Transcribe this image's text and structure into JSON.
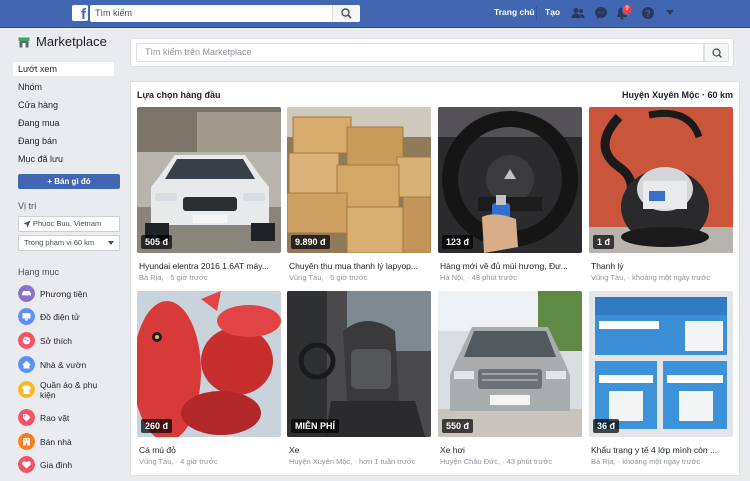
{
  "topbar": {
    "logo": "f",
    "search_placeholder": "Tìm kiếm",
    "home": "Trang chủ",
    "create": "Tạo",
    "notif_count": "9",
    "icons": [
      "friends-icon",
      "messenger-icon",
      "bell-icon",
      "help-icon",
      "caret-down-icon"
    ]
  },
  "sidebar": {
    "title": "Marketplace",
    "nav": [
      {
        "label": "Lướt xem",
        "active": true
      },
      {
        "label": "Nhóm"
      },
      {
        "label": "Cửa hàng"
      },
      {
        "label": "Đang mua"
      },
      {
        "label": "Đang bán"
      },
      {
        "label": "Mục đã lưu"
      }
    ],
    "sell_button": "+ Bán gì đó",
    "location_heading": "Vị trí",
    "location_value": "Phuoc Buu, Vietnam",
    "radius_value": "Trong phạm vi 60 km",
    "categories_heading": "Hạng mục",
    "categories": [
      {
        "label": "Phương tiện",
        "color": "#8c72cb"
      },
      {
        "label": "Đồ điện tử",
        "color": "#5890ff"
      },
      {
        "label": "Sở thích",
        "color": "#f35369"
      },
      {
        "label": "Nhà & vườn",
        "color": "#5890ff"
      },
      {
        "label": "Quần áo & phụ kiện",
        "color": "#f7b928"
      },
      {
        "label": "Rao vặt",
        "color": "#f35369"
      },
      {
        "label": "Bán nhà",
        "color": "#fa7e1e"
      },
      {
        "label": "Gia đình",
        "color": "#f35369"
      }
    ]
  },
  "main": {
    "search_placeholder": "Tìm kiếm trên Marketplace",
    "heading": "Lựa chọn hàng đầu",
    "location": "Huyện Xuyên Mộc · 60 km",
    "listings": [
      {
        "price": "505 đ",
        "title": "Hyundai elentra 2016 1.6AT máy...",
        "sub": "Bà Rịa, · 5 giờ trước",
        "img": "car-white"
      },
      {
        "price": "9.890 đ",
        "title": "Chuyên thu mua thanh lý lapyop...",
        "sub": "Vũng Tàu, · 5 giờ trước",
        "img": "boxes"
      },
      {
        "price": "123 đ",
        "title": "Hàng mới về đủ mùi hương, Đư...",
        "sub": "Hà Nội, · 48 phút trước",
        "img": "steering"
      },
      {
        "price": "1 đ",
        "title": "Thanh lý",
        "sub": "Vũng Tàu, · khoảng một ngày trước",
        "img": "vacuum"
      },
      {
        "price": "260 đ",
        "title": "Cá mú đỏ",
        "sub": "Vũng Tàu, · 4 giờ trước",
        "img": "fish"
      },
      {
        "price": "MIỄN PHÍ",
        "title": "Xe",
        "sub": "Huyện Xuyên Mộc, · hơn 1 tuần trước",
        "img": "interior"
      },
      {
        "price": "550 đ",
        "title": "Xe hơi",
        "sub": "Huyện Châu Đức, · 43 phút trước",
        "img": "car-silver"
      },
      {
        "price": "36 đ",
        "title": "Khẩu trang y tế 4 lớp mình còn ...",
        "sub": "Bà Rịa, · khoảng một ngày trước",
        "img": "masks"
      }
    ]
  }
}
